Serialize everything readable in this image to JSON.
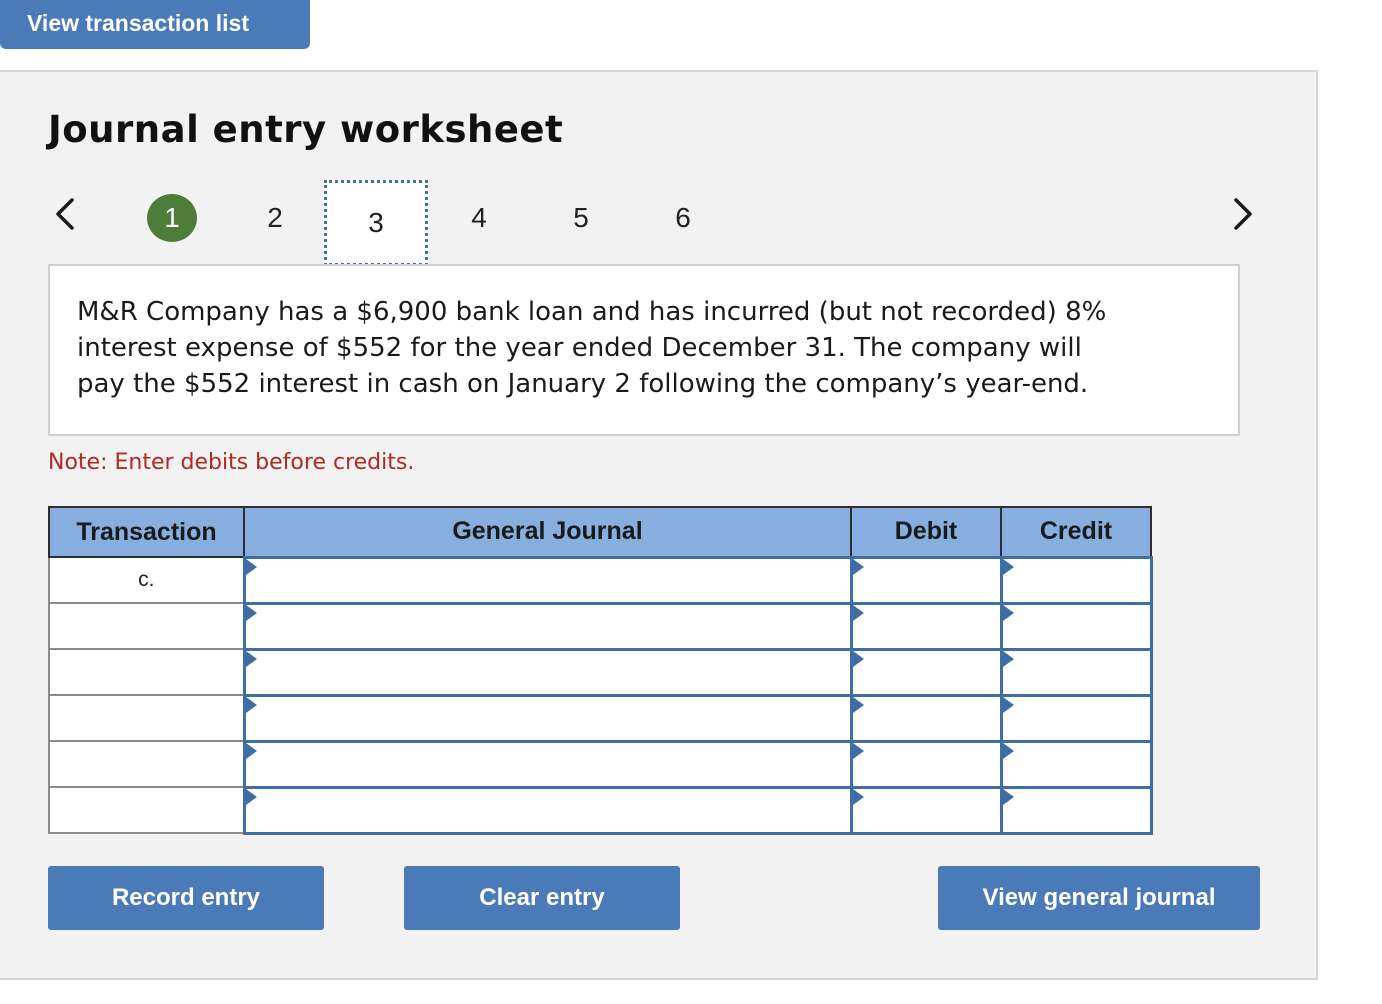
{
  "top_button": {
    "label": "View transaction list"
  },
  "worksheet": {
    "title": "Journal entry worksheet",
    "nav": {
      "prev_icon": "chevron-left-icon",
      "next_icon": "chevron-right-icon"
    },
    "steps": [
      {
        "label": "1",
        "state": "done"
      },
      {
        "label": "2",
        "state": "default"
      },
      {
        "label": "3",
        "state": "current"
      },
      {
        "label": "4",
        "state": "default"
      },
      {
        "label": "5",
        "state": "default"
      },
      {
        "label": "6",
        "state": "default"
      }
    ],
    "description": "M&R Company has a $6,900 bank loan and has incurred (but not recorded) 8% interest expense of $552 for the year ended December 31. The company will pay the $552 interest in cash on January 2 following the company’s year-end.",
    "note": "Note: Enter debits before credits."
  },
  "table": {
    "headers": {
      "transaction": "Transaction",
      "journal": "General Journal",
      "debit": "Debit",
      "credit": "Credit"
    },
    "rows": [
      {
        "transaction": "c.",
        "journal": "",
        "debit": "",
        "credit": ""
      },
      {
        "transaction": "",
        "journal": "",
        "debit": "",
        "credit": ""
      },
      {
        "transaction": "",
        "journal": "",
        "debit": "",
        "credit": ""
      },
      {
        "transaction": "",
        "journal": "",
        "debit": "",
        "credit": ""
      },
      {
        "transaction": "",
        "journal": "",
        "debit": "",
        "credit": ""
      },
      {
        "transaction": "",
        "journal": "",
        "debit": "",
        "credit": ""
      }
    ]
  },
  "buttons": {
    "record": "Record entry",
    "clear": "Clear entry",
    "view_journal": "View general journal"
  },
  "colors": {
    "primary_button": "#4a7ab8",
    "header_fill": "#86aede",
    "step_done": "#4e7d3a",
    "note_text": "#b02a1e"
  }
}
